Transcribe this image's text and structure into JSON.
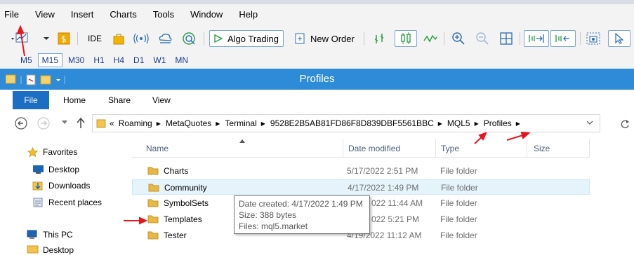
{
  "menubar": {
    "items": [
      "File",
      "View",
      "Insert",
      "Charts",
      "Tools",
      "Window",
      "Help"
    ]
  },
  "toolbar": {
    "ide_label": "IDE",
    "algo_trading_label": "Algo Trading",
    "new_order_label": "New Order",
    "icons": [
      "new-chart-icon",
      "dollar-icon",
      "ide-icon",
      "market-bag-icon",
      "signal-icon",
      "cloud-icon",
      "vps-icon",
      "play-icon",
      "new-order-icon",
      "bar-chart-icon",
      "candlestick-icon",
      "line-chart-icon",
      "zoom-in-icon",
      "zoom-out-icon",
      "grid-icon",
      "autoscroll-icon",
      "chart-shift-icon",
      "screenshot-icon",
      "cursor-icon"
    ]
  },
  "timeframes": {
    "items": [
      "M5",
      "M15",
      "M30",
      "H1",
      "H4",
      "D1",
      "W1",
      "MN"
    ],
    "active": "M15"
  },
  "explorer": {
    "title": "Profiles",
    "ribbon_tabs": [
      "File",
      "Home",
      "Share",
      "View"
    ],
    "address": {
      "prefix": "«",
      "crumbs": [
        "Roaming",
        "MetaQuotes",
        "Terminal",
        "9528E2B5AB81FD86F8D839DBF5561BBC",
        "MQL5",
        "Profiles"
      ]
    },
    "nav": {
      "favorites": "Favorites",
      "favorite_items": [
        "Desktop",
        "Downloads",
        "Recent places"
      ],
      "this_pc": "This PC",
      "this_pc_items": [
        "Desktop"
      ]
    },
    "columns": [
      "Name",
      "Date modified",
      "Type",
      "Size"
    ],
    "rows": [
      {
        "name": "Charts",
        "date": "5/17/2022 2:51 PM",
        "type": "File folder",
        "size": ""
      },
      {
        "name": "Community",
        "date": "4/17/2022 1:49 PM",
        "type": "File folder",
        "size": ""
      },
      {
        "name": "SymbolSets",
        "date": "022 11:44 AM",
        "type": "File folder",
        "size": ""
      },
      {
        "name": "Templates",
        "date": "022 5:21 PM",
        "type": "File folder",
        "size": ""
      },
      {
        "name": "Tester",
        "date": "4/19/2022 11:12 AM",
        "type": "File folder",
        "size": ""
      }
    ],
    "tooltip": {
      "line1": "Date created: 4/17/2022 1:49 PM",
      "line2": "Size: 388 bytes",
      "line3": "Files: mql5.market"
    }
  },
  "colors": {
    "title_bar": "#2e8bd8",
    "file_tab": "#1b6ec2",
    "annotation_arrow": "#e8141b",
    "folder": "#e8b844"
  }
}
